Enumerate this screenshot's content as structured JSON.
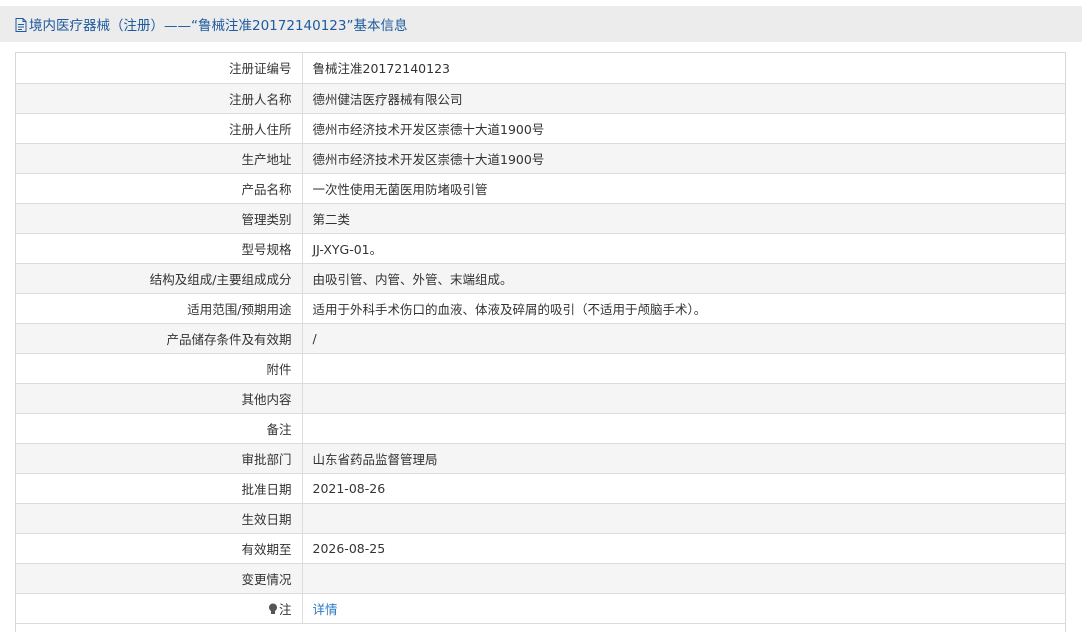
{
  "header": {
    "title": "境内医疗器械（注册）——“鲁械注准20172140123”基本信息",
    "icon": "document-icon"
  },
  "rows": [
    {
      "label": "注册证编号",
      "value": "鲁械注准20172140123"
    },
    {
      "label": "注册人名称",
      "value": "德州健洁医疗器械有限公司"
    },
    {
      "label": "注册人住所",
      "value": "德州市经济技术开发区崇德十大道1900号"
    },
    {
      "label": "生产地址",
      "value": "德州市经济技术开发区崇德十大道1900号"
    },
    {
      "label": "产品名称",
      "value": "一次性使用无菌医用防堵吸引管"
    },
    {
      "label": "管理类别",
      "value": "第二类"
    },
    {
      "label": "型号规格",
      "value": "JJ-XYG-01。"
    },
    {
      "label": "结构及组成/主要组成成分",
      "value": "由吸引管、内管、外管、末端组成。"
    },
    {
      "label": "适用范围/预期用途",
      "value": "适用于外科手术伤口的血液、体液及碎屑的吸引（不适用于颅脑手术）。"
    },
    {
      "label": "产品储存条件及有效期",
      "value": "/"
    },
    {
      "label": "附件",
      "value": ""
    },
    {
      "label": "其他内容",
      "value": ""
    },
    {
      "label": "备注",
      "value": ""
    },
    {
      "label": "审批部门",
      "value": "山东省药品监督管理局"
    },
    {
      "label": "批准日期",
      "value": "2021-08-26"
    },
    {
      "label": "生效日期",
      "value": ""
    },
    {
      "label": "有效期至",
      "value": "2026-08-25"
    },
    {
      "label": "变更情况",
      "value": ""
    }
  ],
  "note": {
    "label": "注",
    "link": "详情",
    "icon": "lightbulb-icon"
  },
  "colors": {
    "title": "#1e5a9e",
    "link": "#2b78c4",
    "alt_row": "#f5f5f5",
    "header_bg": "#ececec"
  }
}
